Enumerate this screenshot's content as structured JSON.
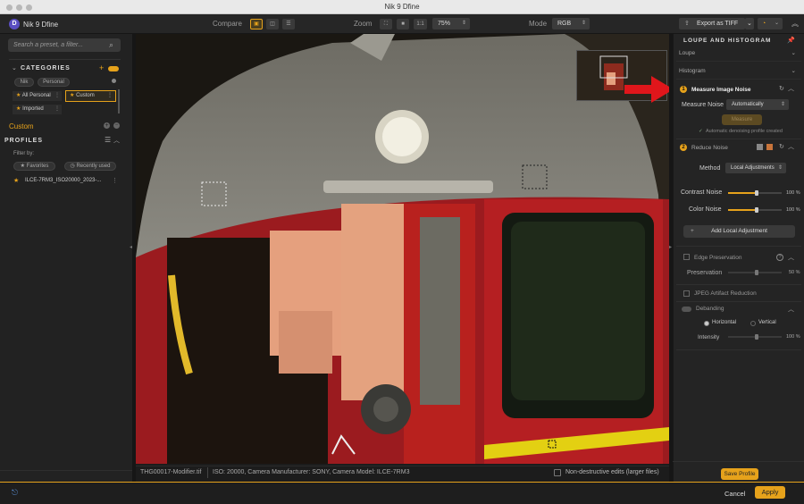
{
  "window": {
    "title": "Nik 9 Dfine"
  },
  "app": {
    "name": "Nik 9 Dfine",
    "logo_letter": "D"
  },
  "toolbar": {
    "compare_label": "Compare",
    "zoom_label": "Zoom",
    "zoom_1to1": "1:1",
    "zoom_value": "75%",
    "mode_label": "Mode",
    "mode_value": "RGB",
    "export_label": "Export as TIFF"
  },
  "left": {
    "search_placeholder": "Search a preset, a filter...",
    "categories_label": "CATEGORIES",
    "tabs": [
      "Nik",
      "Personal"
    ],
    "chips": [
      {
        "label": "All Personal"
      },
      {
        "label": "Custom"
      },
      {
        "label": "Imported"
      }
    ],
    "custom_label": "Custom",
    "profiles_label": "PROFILES",
    "filter_by": "Filter by:",
    "favorites": "Favorites",
    "recently_used": "Recently used",
    "profile_item": "ILCE-7RM3_ISO20000_2023-..."
  },
  "info": {
    "filename": "THG00017-Modifier.tif",
    "meta": "ISO: 20000, Camera Manufacturer: SONY, Camera Model: ILCE-7RM3",
    "nondestructive": "Non-destructive edits (larger files)"
  },
  "right": {
    "header": "LOUPE AND HISTOGRAM",
    "loupe": "Loupe",
    "histogram": "Histogram",
    "step1_num": "1",
    "step1_title": "Measure Image Noise",
    "measure_noise_label": "Measure Noise",
    "measure_noise_value": "Automatically",
    "measure_button": "Measure",
    "auto_profile": "Automatic denoising profile created",
    "step2_num": "2",
    "step2_title": "Reduce Noise",
    "method_label": "Method",
    "method_value": "Local Adjustments",
    "contrast_noise": "Contrast Noise",
    "contrast_value": "100 %",
    "color_noise": "Color Noise",
    "color_value": "100 %",
    "add_local": "Add Local Adjustment",
    "edge_preservation": "Edge Preservation",
    "preservation": "Preservation",
    "preservation_value": "50 %",
    "jpeg_reduction": "JPEG Artifact Reduction",
    "debanding": "Debanding",
    "horizontal": "Horizontal",
    "vertical": "Vertical",
    "intensity": "Intensity",
    "intensity_value": "100 %",
    "save_profile": "Save Profile"
  },
  "footer": {
    "cancel": "Cancel",
    "apply": "Apply"
  },
  "levels": {
    "contrast_noise": 100,
    "color_noise": 100,
    "preservation": 50,
    "intensity": 100
  },
  "colors": {
    "accent": "#e6a21b",
    "arrow": "#e0161b",
    "logo": "#5a4ec2"
  }
}
